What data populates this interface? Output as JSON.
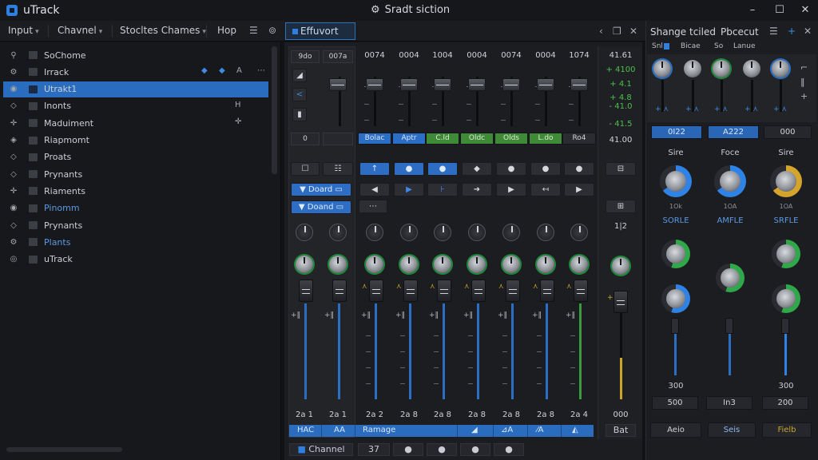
{
  "app": {
    "title": "uTrack",
    "window_title": "Sradt siction",
    "window_icon": "gear-icon"
  },
  "window_controls": {
    "minimize": "–",
    "maximize": "☐",
    "close": "✕"
  },
  "menubar": {
    "items": [
      {
        "label": "Input",
        "caret": "▾"
      },
      {
        "label": "Chavnel",
        "caret": "▾"
      },
      {
        "label": "Stocltes  Chames",
        "caret": "▾"
      },
      {
        "label": "Hop",
        "caret": ""
      }
    ],
    "effort_tab": "Effuvort"
  },
  "tracklist": {
    "rows": [
      {
        "label": "SoChome",
        "icon": "search-icon",
        "glyph": "⚲"
      },
      {
        "label": "Irrack",
        "icon": "gear-icon",
        "glyph": "⚙",
        "right": [
          "◆",
          "◆",
          "A",
          "⋯"
        ]
      },
      {
        "label": "Utrakt1",
        "icon": "target-icon",
        "glyph": "◉",
        "selected": true
      },
      {
        "label": "Inonts",
        "icon": "diamond-icon",
        "glyph": "◇",
        "right": [
          "H"
        ]
      },
      {
        "label": "Maduiment",
        "icon": "crosshair-icon",
        "glyph": "✛",
        "right": [
          "✛"
        ]
      },
      {
        "label": "Riapmomt",
        "icon": "diamond-icon",
        "glyph": "◈"
      },
      {
        "label": "Proats",
        "icon": "diamond-icon",
        "glyph": "◇"
      },
      {
        "label": "Prynants",
        "icon": "diamond-icon",
        "glyph": "◇"
      },
      {
        "label": "Riaments",
        "icon": "crosshair-icon",
        "glyph": "✛"
      },
      {
        "label": "Pinomm",
        "icon": "target-icon",
        "glyph": "◉",
        "blue": true
      },
      {
        "label": "Prynants",
        "icon": "diamond-icon",
        "glyph": "◇"
      },
      {
        "label": "Plants",
        "icon": "gear-icon",
        "glyph": "⚙",
        "blue": true
      },
      {
        "label": "uTrack",
        "icon": "target-icon",
        "glyph": "◎"
      }
    ]
  },
  "mixer": {
    "sidebar": {
      "levels": [
        "9do",
        "007a"
      ],
      "value_boxes": [
        "0",
        ""
      ],
      "icon_buttons": [
        "☐",
        "☷"
      ],
      "dropdowns": [
        "Doard",
        "Doand"
      ]
    },
    "channels": [
      {
        "level": "0074",
        "name": "Bolac",
        "color": "blue",
        "bottom": "2a  2"
      },
      {
        "level": "0004",
        "name": "Aptr",
        "color": "blue",
        "bottom": "2a  8"
      },
      {
        "level": "1004",
        "name": "C.ld",
        "color": "green",
        "bottom": "2a  8"
      },
      {
        "level": "0004",
        "name": "Oldc",
        "color": "green",
        "bottom": "2a  8"
      },
      {
        "level": "0074",
        "name": "Olds",
        "color": "green",
        "bottom": "2a  8"
      },
      {
        "level": "0004",
        "name": "L.do",
        "color": "green",
        "bottom": "2a  8"
      },
      {
        "level": "1074",
        "name": "Ro4",
        "color": "gray",
        "bottom": "2a  4"
      }
    ],
    "sidebar_bottom": [
      "2a  1",
      "2a  1"
    ],
    "transport_row1": [
      "↑",
      "●",
      "●",
      "◆",
      "●",
      "●",
      "●"
    ],
    "transport_row2": [
      "◀",
      "▶",
      "⊦",
      "➜",
      "▶",
      "↤",
      "▶"
    ],
    "small_button": "⋯",
    "bottom_bar": [
      "HAC",
      "AA",
      "Ramage",
      "◢",
      "⊿A",
      "⁄A",
      "◭"
    ],
    "footer": [
      "Channel",
      "37",
      "●",
      "●",
      "●",
      "●"
    ]
  },
  "master": {
    "values": [
      "41.61",
      "+ 4100",
      "+ 4.1",
      "+ 4.8",
      "- 41.0",
      "- 41.5",
      "41.00"
    ],
    "label_mid": "1|2",
    "bottom_value": "000",
    "bottom_label": "Bat"
  },
  "right_panel": {
    "titles": [
      "Shange tciled",
      "Pbcecut"
    ],
    "tabs": [
      "Snl",
      "Bicae",
      "So",
      "Lanue"
    ],
    "top_buttons": [
      "0I22",
      "A222",
      "000"
    ],
    "knob_labels": [
      "Sire",
      "Foce",
      "Sire"
    ],
    "knob_sublabels": [
      "1Ok",
      "1OA",
      "1OA"
    ],
    "section_labels": [
      "SORLE",
      "AMFLE",
      "SRFLE"
    ],
    "values": [
      "300",
      "",
      "300"
    ],
    "value_boxes": [
      "500",
      "In3",
      "200"
    ],
    "bottom_buttons": [
      "Aeio",
      "Seis",
      "Fielb"
    ],
    "accent_colors": {
      "blue": "#2f82e6",
      "green": "#2fa84a",
      "gold": "#d4a52a"
    }
  }
}
